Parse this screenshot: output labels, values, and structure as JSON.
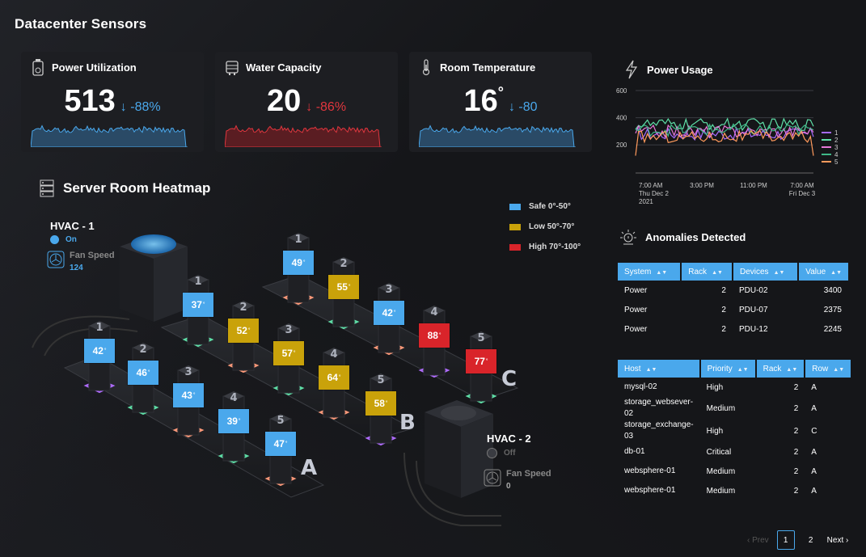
{
  "page": {
    "title": "Datacenter Sensors"
  },
  "kpis": [
    {
      "title": "Power Utilization",
      "value": "513",
      "unit": "",
      "delta": "-88%",
      "trend": "down",
      "color": "#4aa8ec",
      "icon": "battery-icon"
    },
    {
      "title": "Water Capacity",
      "value": "20",
      "unit": "",
      "delta": "-86%",
      "trend": "down",
      "color": "#e0363e",
      "icon": "water-tank-icon"
    },
    {
      "title": "Room Temperature",
      "value": "16",
      "unit": "°",
      "delta": "-80",
      "trend": "down",
      "color": "#4aa8ec",
      "icon": "thermometer-icon"
    }
  ],
  "heatmap": {
    "title": "Server Room Heatmap",
    "legend": [
      {
        "label": "Safe 0°-50°",
        "color": "#4aa8ec"
      },
      {
        "label": "Low 50°-70°",
        "color": "#c9a20a"
      },
      {
        "label": "High 70°-100°",
        "color": "#d9242a"
      }
    ],
    "hvac1": {
      "name": "HVAC - 1",
      "status": "On",
      "fan_label": "Fan Speed",
      "fan_value": "124"
    },
    "hvac2": {
      "name": "HVAC - 2",
      "status": "Off",
      "fan_label": "Fan Speed",
      "fan_value": "0"
    },
    "rows": [
      {
        "label": "A",
        "sensors": [
          {
            "num": "1",
            "temp": "42"
          },
          {
            "num": "2",
            "temp": "46"
          },
          {
            "num": "3",
            "temp": "43"
          },
          {
            "num": "4",
            "temp": "39"
          },
          {
            "num": "5",
            "temp": "47"
          }
        ]
      },
      {
        "label": "B",
        "sensors": [
          {
            "num": "1",
            "temp": "37"
          },
          {
            "num": "2",
            "temp": "52"
          },
          {
            "num": "3",
            "temp": "57"
          },
          {
            "num": "4",
            "temp": "64"
          },
          {
            "num": "5",
            "temp": "58"
          }
        ]
      },
      {
        "label": "C",
        "sensors": [
          {
            "num": "1",
            "temp": "49"
          },
          {
            "num": "2",
            "temp": "55"
          },
          {
            "num": "3",
            "temp": "42"
          },
          {
            "num": "4",
            "temp": "88"
          },
          {
            "num": "5",
            "temp": "77"
          }
        ]
      }
    ]
  },
  "power_usage": {
    "title": "Power Usage",
    "y_ticks": [
      "600",
      "400",
      "200"
    ],
    "x_ticks": [
      {
        "l1": "7:00 AM",
        "l2": "Thu Dec 2",
        "l3": "2021"
      },
      {
        "l1": "3:00 PM",
        "l2": "",
        "l3": ""
      },
      {
        "l1": "11:00 PM",
        "l2": "",
        "l3": ""
      },
      {
        "l1": "7:00 AM",
        "l2": "Fri Dec 3",
        "l3": ""
      }
    ],
    "series": [
      {
        "name": "1",
        "color": "#a66bff"
      },
      {
        "name": "2",
        "color": "#5fe0a8"
      },
      {
        "name": "3",
        "color": "#e878d8"
      },
      {
        "name": "4",
        "color": "#3fb888"
      },
      {
        "name": "5",
        "color": "#ff9a5c"
      }
    ]
  },
  "anomalies": {
    "title": "Anomalies Detected",
    "table1": {
      "headers": [
        "System",
        "Rack",
        "Devices",
        "Value"
      ],
      "rows": [
        [
          "Power",
          "2",
          "PDU-02",
          "3400"
        ],
        [
          "Power",
          "2",
          "PDU-07",
          "2375"
        ],
        [
          "Power",
          "2",
          "PDU-12",
          "2245"
        ]
      ]
    },
    "table2": {
      "headers": [
        "Host",
        "Priority",
        "Rack",
        "Row"
      ],
      "rows": [
        [
          "mysql-02",
          "High",
          "2",
          "A"
        ],
        [
          "storage_websever-02",
          "Medium",
          "2",
          "A"
        ],
        [
          "storage_exchange-03",
          "High",
          "2",
          "C"
        ],
        [
          "db-01",
          "Critical",
          "2",
          "A"
        ],
        [
          "websphere-01",
          "Medium",
          "2",
          "A"
        ],
        [
          "websphere-01",
          "Medium",
          "2",
          "A"
        ]
      ]
    },
    "pager": {
      "prev": "Prev",
      "pages": [
        "1",
        "2"
      ],
      "current": "1",
      "next": "Next"
    }
  }
}
